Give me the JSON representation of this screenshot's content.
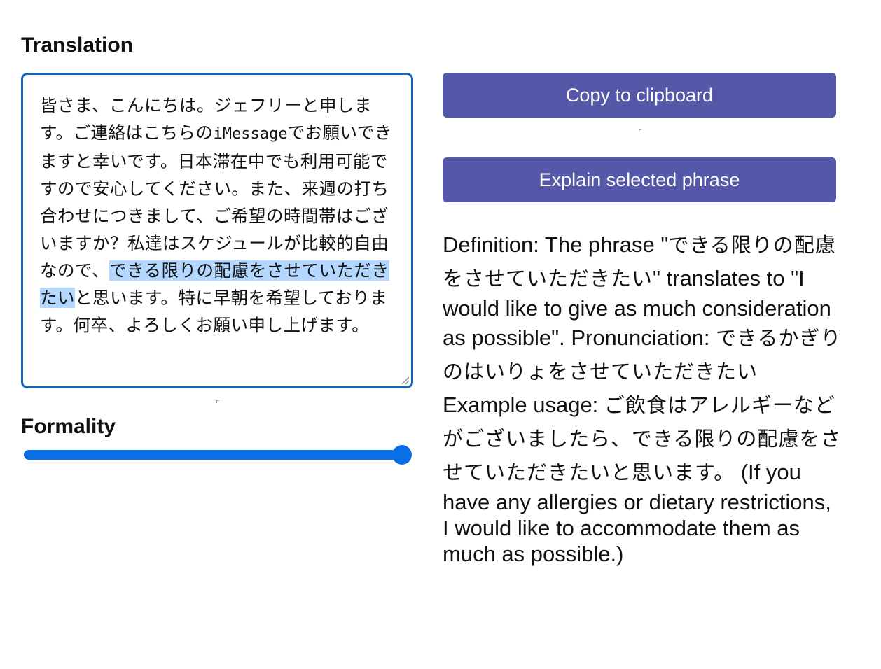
{
  "translation": {
    "label": "Translation",
    "text_before_mono": "皆さま、こんにちは。ジェフリーと申します。ご連絡はこちらの",
    "text_mono": "iMessage",
    "text_after_mono": "でお願いできますと幸いです。日本滞在中でも利用可能ですので安心してください。また、来週の打ち合わせにつきまして、ご希望の時間帯はございますか？私達はスケジュールが比較的自由なので、",
    "text_selected": "できる限りの配慮をさせていただきたい",
    "text_after_selected": "と思います。特に早朝を希望しております。何卒、よろしくお願い申し上げます。"
  },
  "formality": {
    "label": "Formality",
    "value": 1.0
  },
  "buttons": {
    "copy_label": "Copy to clipboard",
    "explain_label": "Explain selected phrase"
  },
  "explanation": {
    "p1": "Definition: The phrase \"",
    "p1_jp": "できる限りの配慮をさせていただきたい",
    "p2": "\" translates to \"I would like to give as much consideration as possible\". Pronunciation: ",
    "p2_jp": "できるかぎりのはいりょをさせていただきたい",
    "p3": " Example usage: ",
    "p3_jp": "ご飲食はアレルギーなどがございましたら、できる限りの配慮をさせていただきたいと思います。",
    "p4": " (If you have any allergies or dietary restrictions, I would like to accommodate them as much as possible.)"
  },
  "colors": {
    "accent_button": "#5558a8",
    "textarea_border": "#1565c0",
    "slider": "#0a6fe6",
    "selection": "#b4d7ff"
  }
}
